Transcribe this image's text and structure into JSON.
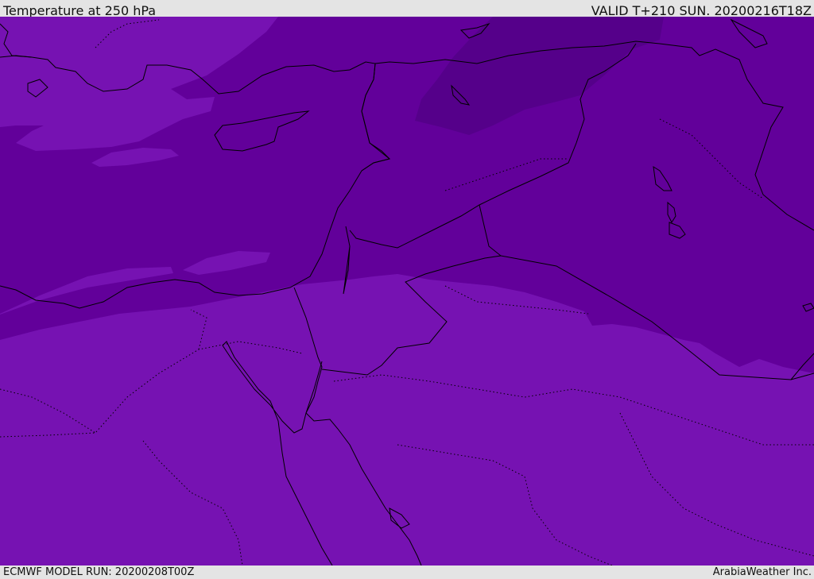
{
  "header": {
    "title": "Temperature at 250 hPa",
    "valid_time": "VALID T+210 SUN. 20200216T18Z"
  },
  "footer": {
    "model_run": "ECMWF MODEL RUN: 20200208T00Z",
    "credit": "ArabiaWeather Inc."
  },
  "map": {
    "colors": {
      "band_warm": "#7612b2",
      "band_mid": "#62009a",
      "band_cold": "#55008a",
      "coastline": "#000000"
    }
  }
}
